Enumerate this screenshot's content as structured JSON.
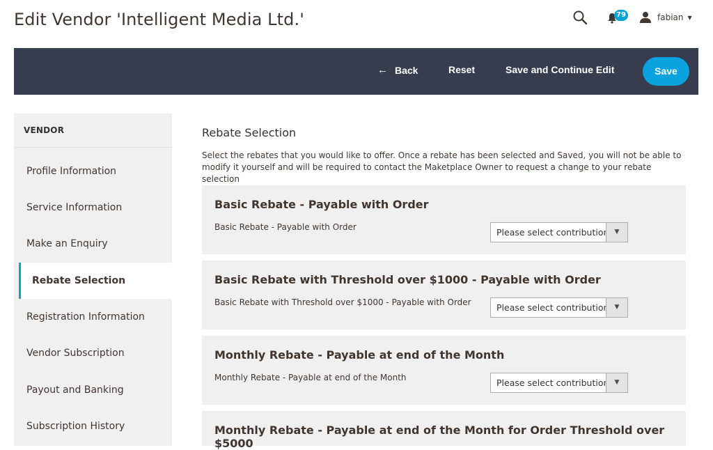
{
  "header": {
    "title": "Edit Vendor 'Intelligent Media Ltd.'",
    "notification_count": "79",
    "username": "fabian"
  },
  "toolbar": {
    "back_label": "Back",
    "reset_label": "Reset",
    "save_continue_label": "Save and Continue Edit",
    "save_label": "Save"
  },
  "sidebar": {
    "heading": "VENDOR",
    "items": [
      {
        "label": "Profile Information"
      },
      {
        "label": "Service Information"
      },
      {
        "label": "Make an Enquiry"
      },
      {
        "label": "Rebate Selection",
        "active": true
      },
      {
        "label": "Registration Information"
      },
      {
        "label": "Vendor Subscription"
      },
      {
        "label": "Payout and Banking"
      },
      {
        "label": "Subscription History"
      }
    ]
  },
  "main": {
    "title": "Rebate Selection",
    "description": "Select the rebates that you would like to offer. Once a rebate has been selected and Saved, you will not be able to modify it yourself and will be required to contact the Maketplace Owner to request a change to your rebate selection",
    "rebates": [
      {
        "title": "Basic Rebate - Payable with Order",
        "subtitle": "Basic Rebate - Payable with Order",
        "select_value": "Please select contribution"
      },
      {
        "title": "Basic Rebate with Threshold over $1000 - Payable with Order",
        "subtitle": "Basic Rebate with Threshold over $1000 - Payable with Order",
        "select_value": "Please select contribution"
      },
      {
        "title": "Monthly Rebate - Payable at end of the Month",
        "subtitle": "Monthly Rebate - Payable at end of the Month",
        "select_value": "Please select contribution"
      },
      {
        "title": "Monthly Rebate - Payable at end of the Month for Order Threshold over $5000"
      }
    ]
  },
  "colors": {
    "toolbar_bg": "#373c4f",
    "accent": "#0aa3e0",
    "card_bg": "#f0f0f0"
  }
}
